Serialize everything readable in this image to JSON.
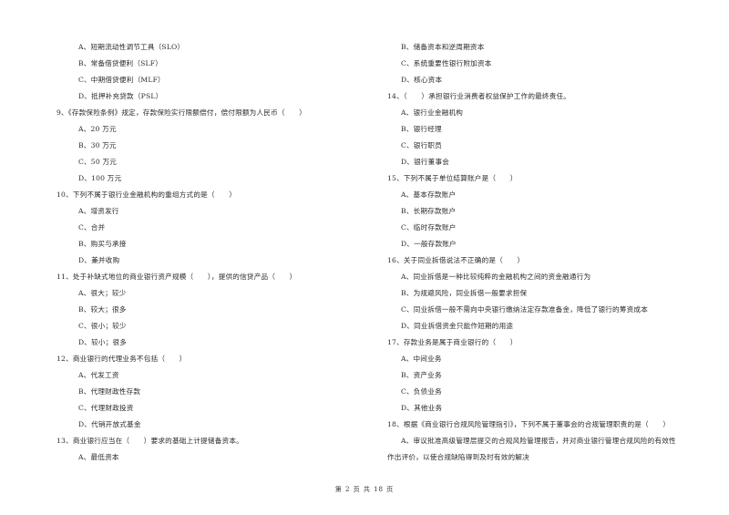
{
  "left_column": [
    {
      "type": "opt",
      "text": "A、短期流动性调节工具（SLO）"
    },
    {
      "type": "opt",
      "text": "B、常备借贷便利（SLF）"
    },
    {
      "type": "opt",
      "text": "C、中期借贷便利（MLF）"
    },
    {
      "type": "opt",
      "text": "D、抵押补充贷款（PSL）"
    },
    {
      "type": "q",
      "text": "9、《存款保险条例》规定，存款保险实行限额偿付，偿付限额为人民币（　　）"
    },
    {
      "type": "opt",
      "text": "A、20 万元"
    },
    {
      "type": "opt",
      "text": "B、30 万元"
    },
    {
      "type": "opt",
      "text": "C、50 万元"
    },
    {
      "type": "opt",
      "text": "D、100 万元"
    },
    {
      "type": "q",
      "text": "10、下列不属于银行业金融机构的重组方式的是（　　）"
    },
    {
      "type": "opt",
      "text": "A、增资发行"
    },
    {
      "type": "opt",
      "text": "C、合并"
    },
    {
      "type": "opt",
      "text": "B、购买与承接"
    },
    {
      "type": "opt",
      "text": "D、兼并收购"
    },
    {
      "type": "q",
      "text": "11、处于补缺式地位的商业银行资产规模（　　），提供的信贷产品（　　）"
    },
    {
      "type": "opt",
      "text": "A、很大；较少"
    },
    {
      "type": "opt",
      "text": "B、较大；很多"
    },
    {
      "type": "opt",
      "text": "C、很小；较少"
    },
    {
      "type": "opt",
      "text": "D、较小；很多"
    },
    {
      "type": "q",
      "text": "12、商业银行的代理业务不包括（　　）"
    },
    {
      "type": "opt",
      "text": "A、代发工资"
    },
    {
      "type": "opt",
      "text": "B、代理财政性存款"
    },
    {
      "type": "opt",
      "text": "C、代理财政投资"
    },
    {
      "type": "opt",
      "text": "D、代销开放式基金"
    },
    {
      "type": "q",
      "text": "13、商业银行应当在（　　）要求的基础上计提储备资本。"
    },
    {
      "type": "opt",
      "text": "A、最低资本"
    }
  ],
  "right_column": [
    {
      "type": "opt",
      "text": "B、储备资本和逆周期资本"
    },
    {
      "type": "opt",
      "text": "C、系统重要性银行附加资本"
    },
    {
      "type": "opt",
      "text": "D、核心资本"
    },
    {
      "type": "q",
      "text": "14、（　　）承担银行业消费者权益保护工作的最终责任。"
    },
    {
      "type": "opt",
      "text": "A、银行业金融机构"
    },
    {
      "type": "opt",
      "text": "B、银行经理"
    },
    {
      "type": "opt",
      "text": "C、银行职员"
    },
    {
      "type": "opt",
      "text": "D、银行董事会"
    },
    {
      "type": "q",
      "text": "15、下列不属于单位结算账户是（　　）"
    },
    {
      "type": "opt",
      "text": "A、基本存款账户"
    },
    {
      "type": "opt",
      "text": "B、长期存款账户"
    },
    {
      "type": "opt",
      "text": "C、临时存款账户"
    },
    {
      "type": "opt",
      "text": "D、一般存款账户"
    },
    {
      "type": "q",
      "text": "16、关于同业拆借说法不正确的是（　　）"
    },
    {
      "type": "opt",
      "text": "A、同业拆借是一种比较纯粹的金融机构之间的资金融通行为"
    },
    {
      "type": "opt",
      "text": "B、为规避风险，同业拆借一般要求担保"
    },
    {
      "type": "opt",
      "text": "C、同业拆借一般不需向中央银行缴纳法定存款准备金，降低了银行的筹资成本"
    },
    {
      "type": "opt",
      "text": "D、同业拆借资金只能作短期的用途"
    },
    {
      "type": "q",
      "text": "17、存款业务是属于商业银行的（　　）"
    },
    {
      "type": "opt",
      "text": "A、中间业务"
    },
    {
      "type": "opt",
      "text": "B、资产业务"
    },
    {
      "type": "opt",
      "text": "C、负债业务"
    },
    {
      "type": "opt",
      "text": "D、其他业务"
    },
    {
      "type": "q",
      "text": "18、根据《商业银行合规风险管理指引》，下列不属于董事会的合规管理职责的是（　　）"
    },
    {
      "type": "opt",
      "text": "A、审议批准高级管理层提交的合规风险管理报告，并对商业银行管理合规风险的有效性"
    },
    {
      "type": "cont",
      "text": "作出评价，以使合规缺陷得到及时有效的解决"
    }
  ],
  "footer": {
    "page_label": "第 2 页 共 18 页"
  }
}
